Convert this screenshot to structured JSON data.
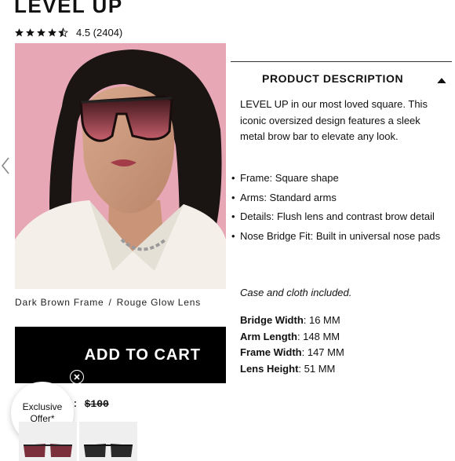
{
  "product": {
    "title": "LEVEL UP",
    "rating_text": "4.5 (2404)",
    "rating_value": 4.5,
    "rating_max": 5
  },
  "variant": {
    "frame": "Dark Brown Frame",
    "separator": "/",
    "lens": "Rouge Glow Lens"
  },
  "cart": {
    "add_label": "ADD TO CART",
    "price_prefix": ": ",
    "price": "$100"
  },
  "offer": {
    "line1": "Exclusive",
    "line2": "Offer*"
  },
  "description": {
    "header": "PRODUCT DESCRIPTION",
    "text": "LEVEL UP in our most loved square. This iconic oversized design features a sleek metal brow bar to elevate any look.",
    "features": [
      "Frame: Square shape",
      "Arms: Standard arms",
      "Details: Flush lens and contrast brow detail",
      "Nose Bridge Fit: Built in universal nose pads"
    ],
    "case_note": "Case and cloth included.",
    "specs": [
      {
        "label": "Bridge Width",
        "value": ": 16 MM"
      },
      {
        "label": "Arm Length",
        "value": ": 148 MM"
      },
      {
        "label": "Frame Width",
        "value": ": 147 MM"
      },
      {
        "label": "Lens Height",
        "value": ": 51 MM"
      }
    ]
  },
  "colors": {
    "hero_bg": "#e7a7b5",
    "button_bg": "#000000",
    "lens_top": "#3a1418",
    "lens_bottom": "#c8606e"
  },
  "icons": {
    "prev": "chevron-left-icon",
    "collapse": "caret-up-icon",
    "close": "close-icon",
    "star": "star-icon"
  }
}
